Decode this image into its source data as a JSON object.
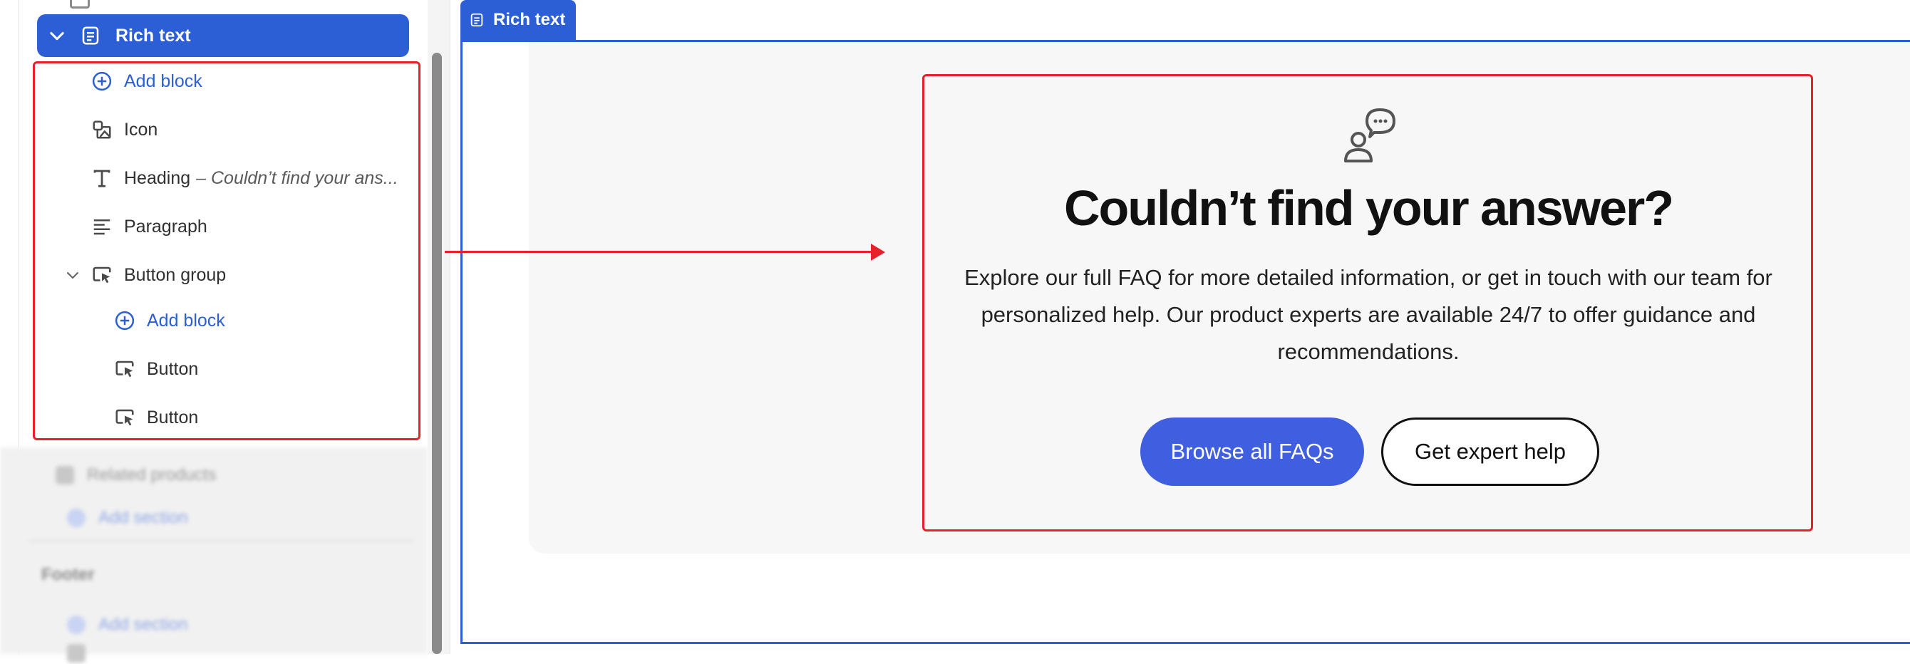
{
  "sidebar": {
    "selected_section": "Rich text",
    "items": [
      {
        "label": "Add block",
        "type": "add"
      },
      {
        "label": "Icon",
        "type": "block"
      },
      {
        "label": "Heading",
        "suffix": "– Couldn’t find your ans...",
        "type": "block"
      },
      {
        "label": "Paragraph",
        "type": "block"
      },
      {
        "label": "Button group",
        "type": "group"
      },
      {
        "label": "Add block",
        "type": "add"
      },
      {
        "label": "Button",
        "type": "block"
      },
      {
        "label": "Button",
        "type": "block"
      }
    ],
    "blurred": {
      "related_products": "Related products",
      "add_section_1": "Add section",
      "footer_heading": "Footer",
      "add_section_2": "Add section"
    }
  },
  "preview": {
    "section_tag": "Rich text",
    "heading": "Couldn’t find your answer?",
    "paragraph": "Explore our full FAQ for more detailed information, or get in touch with our team for personalized help. Our product experts are available 24/7 to offer guidance and recommendations.",
    "primary_button": "Browse all FAQs",
    "secondary_button": "Get expert help"
  },
  "colors": {
    "accent": "#2c5fd6",
    "annotation_red": "#e8202a",
    "button_primary": "#3f5fe0"
  },
  "icons": {
    "selected_row": [
      "chevron-down-icon",
      "document-icon"
    ],
    "add": "plus-circle-icon",
    "icon_block": "image-icon",
    "heading_block": "text-type-icon",
    "paragraph_block": "paragraph-lines-icon",
    "button_block": "cursor-button-icon",
    "preview_feature": "person-chat-icon"
  }
}
